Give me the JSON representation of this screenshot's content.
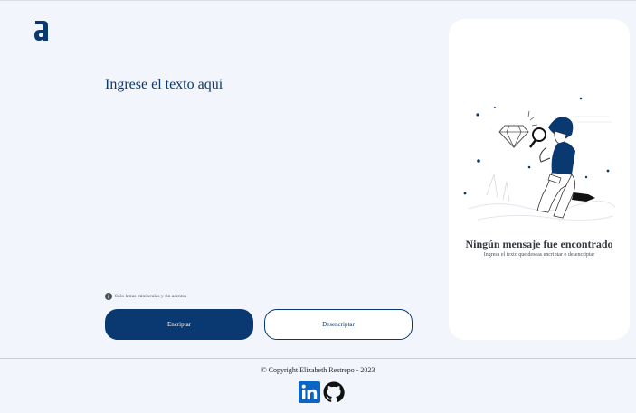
{
  "logo": {
    "icon": "alura-logo-icon",
    "color": "#0a3871"
  },
  "input": {
    "placeholder": "Ingrese el texto aqui",
    "value": ""
  },
  "hint": {
    "icon": "info-icon",
    "text": "Solo letras minúsculas y sin acentos"
  },
  "buttons": {
    "encrypt_label": "Encriptar",
    "decrypt_label": "Desencriptar"
  },
  "result": {
    "title": "Ningún mensaje fue encontrado",
    "subtitle": "Ingresa el texto que deseas encriptar o desencriptar"
  },
  "footer": {
    "copyright": "© Copyright Elizabeth Restrepo - 2023",
    "links": [
      {
        "icon": "linkedin-icon"
      },
      {
        "icon": "github-icon"
      }
    ]
  },
  "colors": {
    "accent": "#0a3871",
    "background": "#f2f5fb",
    "card": "#ffffff"
  }
}
